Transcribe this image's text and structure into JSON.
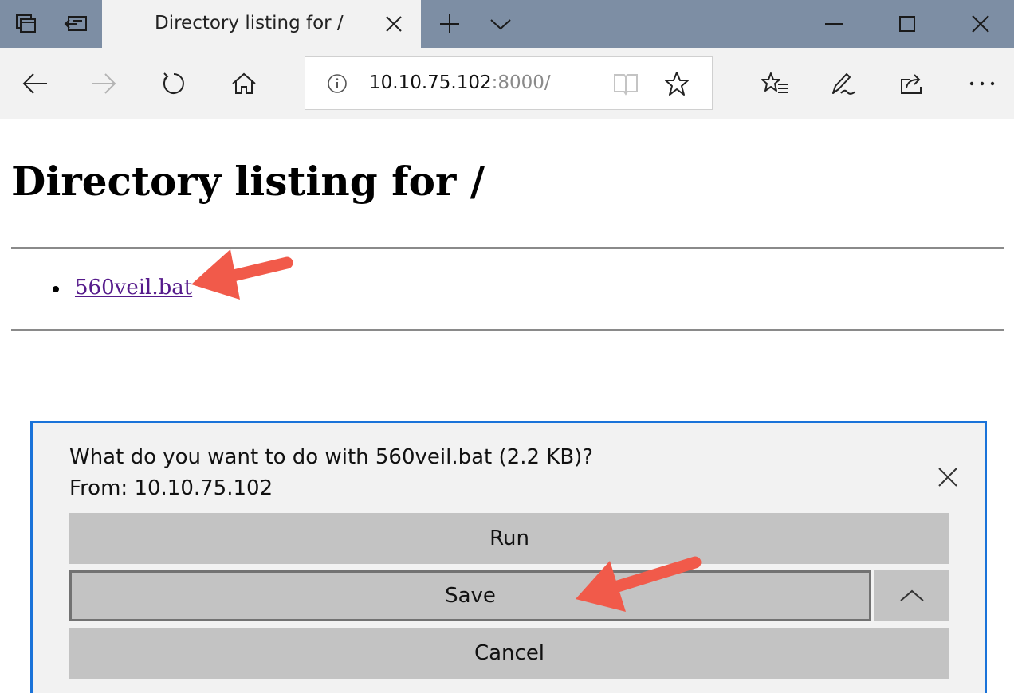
{
  "browser": {
    "tab": {
      "title": "Directory listing for /"
    },
    "address": {
      "host": "10.10.75.102",
      "port": ":8000/"
    }
  },
  "page": {
    "title": "Directory listing for /",
    "files": [
      {
        "name": "560veil.bat"
      }
    ]
  },
  "download_dialog": {
    "question": "What do you want to do with 560veil.bat (2.2 KB)?",
    "source": "From: 10.10.75.102",
    "run_label": "Run",
    "save_label": "Save",
    "cancel_label": "Cancel"
  },
  "colors": {
    "tabbar": "#7d8ea4",
    "link_visited": "#551a8b",
    "dialog_border": "#1a73d9",
    "annotation_arrow": "#f15a4a"
  },
  "icons": {
    "tab_controls": [
      "tab-preview-icon",
      "set-aside-tabs-icon"
    ],
    "nav": [
      "back-icon",
      "forward-icon",
      "refresh-icon",
      "home-icon"
    ],
    "address": [
      "info-icon",
      "reading-view-icon",
      "favorite-star-icon"
    ],
    "toolbar": [
      "favorites-list-icon",
      "pen-icon",
      "share-icon",
      "more-icon"
    ],
    "window": [
      "minimize-icon",
      "maximize-icon",
      "close-icon"
    ]
  }
}
